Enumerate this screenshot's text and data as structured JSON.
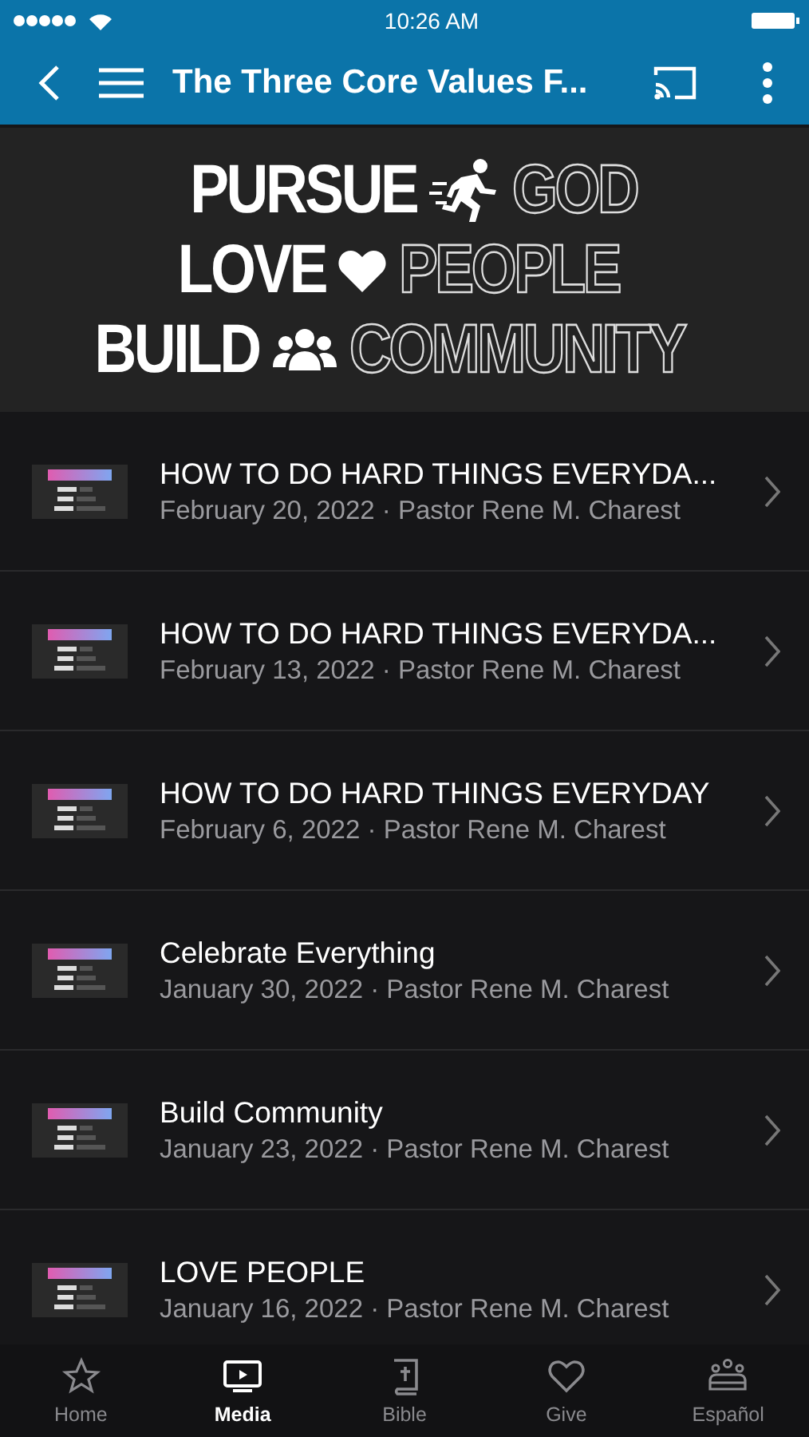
{
  "status_bar": {
    "time": "10:26 AM"
  },
  "header": {
    "title": "The Three Core Values F..."
  },
  "banner": {
    "lines": [
      {
        "solid": "PURSUE",
        "outline": "GOD"
      },
      {
        "solid": "LOVE",
        "outline": "PEOPLE"
      },
      {
        "solid": "BUILD",
        "outline": "COMMUNITY"
      }
    ]
  },
  "sermons": [
    {
      "title": "HOW TO DO HARD THINGS EVERYDA...",
      "subtitle": "February 20, 2022 · Pastor Rene M. Charest"
    },
    {
      "title": "HOW TO DO HARD THINGS EVERYDA...",
      "subtitle": "February 13, 2022 · Pastor Rene M. Charest"
    },
    {
      "title": "HOW TO DO HARD THINGS EVERYDAY",
      "subtitle": "February 6, 2022 · Pastor Rene M. Charest"
    },
    {
      "title": "Celebrate Everything",
      "subtitle": "January 30, 2022 · Pastor Rene M. Charest"
    },
    {
      "title": "Build Community",
      "subtitle": "January 23, 2022 · Pastor Rene M. Charest"
    },
    {
      "title": "LOVE PEOPLE",
      "subtitle": "January 16, 2022 · Pastor Rene M. Charest"
    }
  ],
  "tab_bar": [
    {
      "label": "Home",
      "selected": false
    },
    {
      "label": "Media",
      "selected": true
    },
    {
      "label": "Bible",
      "selected": false
    },
    {
      "label": "Give",
      "selected": false
    },
    {
      "label": "Español",
      "selected": false
    }
  ]
}
